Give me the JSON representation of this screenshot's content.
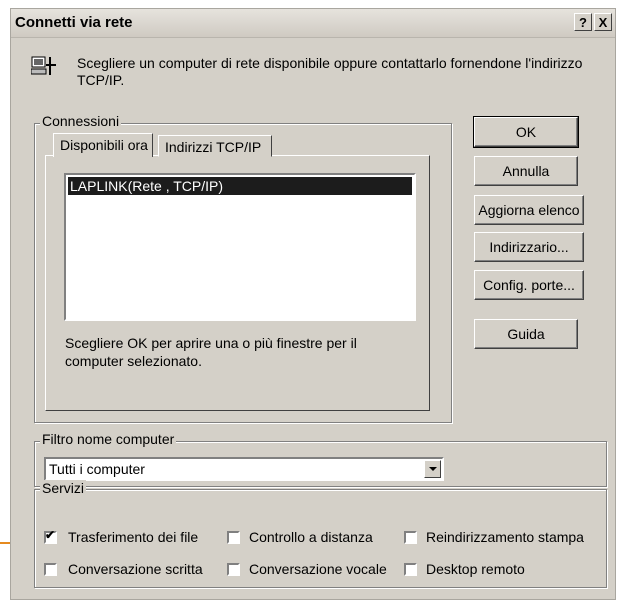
{
  "window": {
    "title": "Connetti via rete",
    "help_label": "?",
    "close_label": "X"
  },
  "intro": {
    "text": "Scegliere un computer di rete disponibile oppure contattarlo fornendone l'indirizzo TCP/IP.",
    "icon": "network-computer-icon"
  },
  "connessioni": {
    "label": "Connessioni",
    "tabs": [
      {
        "label": "Disponibili ora",
        "active": true
      },
      {
        "label": "Indirizzi TCP/IP",
        "active": false
      }
    ],
    "list_items": [
      "LAPLINK(Rete , TCP/IP)"
    ],
    "hint": "Scegliere OK per aprire una o più finestre per il computer selezionato."
  },
  "buttons": {
    "ok": "OK",
    "annulla": "Annulla",
    "aggiorna": "Aggiorna elenco",
    "indirizzario": "Indirizzario...",
    "config": "Config. porte...",
    "guida": "Guida"
  },
  "filtro": {
    "label": "Filtro nome computer",
    "value": "Tutti i computer"
  },
  "servizi": {
    "label": "Servizi",
    "items": [
      {
        "label": "Trasferimento dei file",
        "checked": true
      },
      {
        "label": "Controllo a distanza",
        "checked": false
      },
      {
        "label": "Reindirizzamento stampa",
        "checked": false
      },
      {
        "label": "Conversazione scritta",
        "checked": false
      },
      {
        "label": "Conversazione vocale",
        "checked": false
      },
      {
        "label": "Desktop remoto",
        "checked": false
      }
    ]
  },
  "colors": {
    "arrow": "#e58a1f",
    "dialog_face": "#d4d0c8",
    "selection": "#1c1c1c"
  }
}
